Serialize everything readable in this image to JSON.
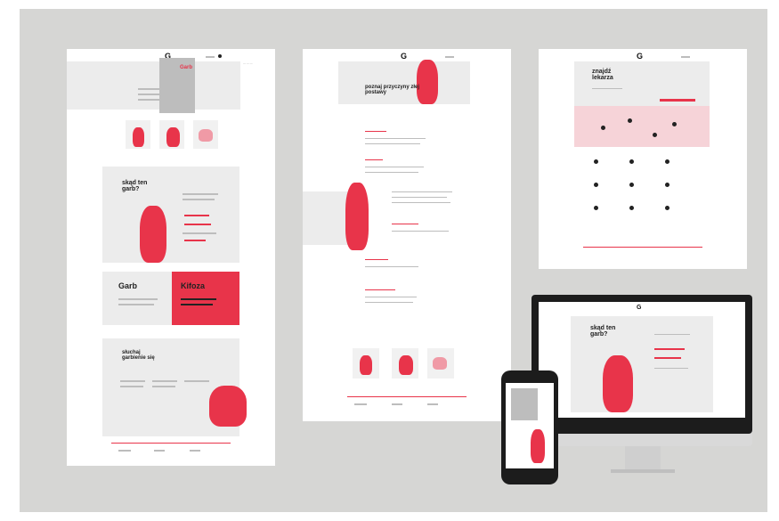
{
  "panel1": {
    "hero_title": "Garb",
    "section_title": "skąd ten garb?",
    "garb_label": "Garb",
    "kifoza_label": "Kifoza",
    "slouch_title": "słuchaj garbienie się"
  },
  "panel2": {
    "hero_title": "poznaj przyczyny złej postawy"
  },
  "panel3": {
    "title": "znajdź lekarza"
  },
  "imac": {
    "title": "skąd ten garb?"
  },
  "colors": {
    "accent": "#e8344a",
    "backdrop": "#d6d6d4",
    "panel": "#ffffff"
  }
}
